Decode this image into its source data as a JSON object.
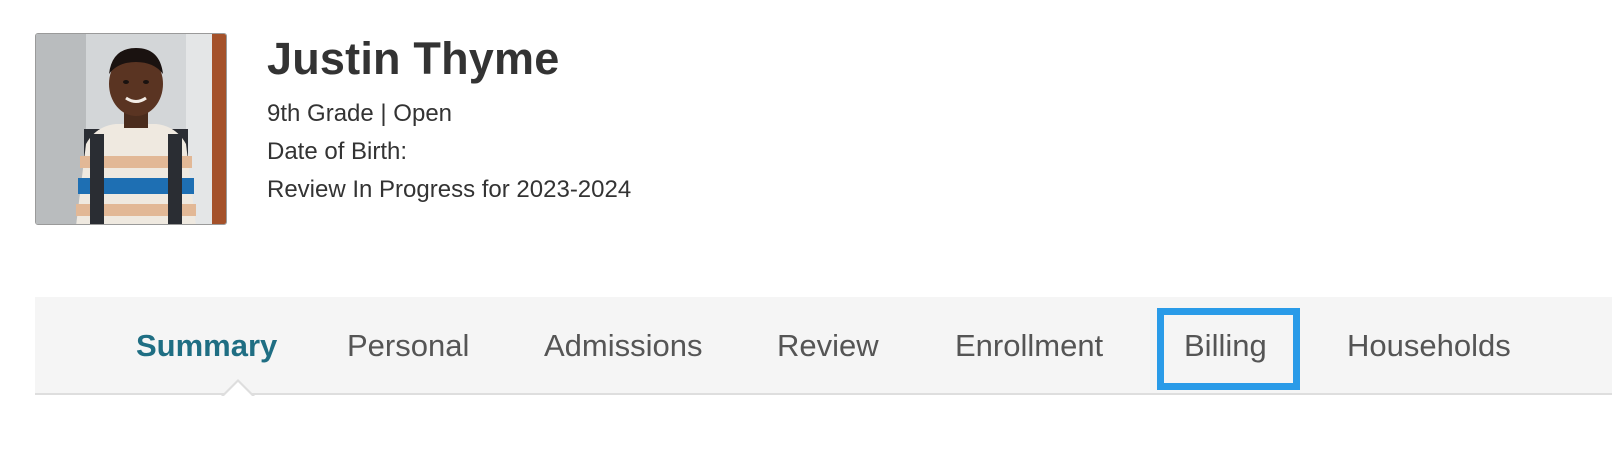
{
  "student": {
    "name": "Justin Thyme",
    "grade_status": "9th Grade | Open",
    "dob_label": "Date of Birth:",
    "review_status": "Review In Progress for 2023-2024"
  },
  "tabs": [
    {
      "label": "Summary",
      "active": true
    },
    {
      "label": "Personal",
      "active": false
    },
    {
      "label": "Admissions",
      "active": false
    },
    {
      "label": "Review",
      "active": false
    },
    {
      "label": "Enrollment",
      "active": false
    },
    {
      "label": "Billing",
      "active": false,
      "highlighted": true
    },
    {
      "label": "Households",
      "active": false
    }
  ],
  "colors": {
    "active_tab": "#1f6e83",
    "highlight_border": "#2a9be8",
    "tabbar_bg": "#f5f5f5"
  }
}
